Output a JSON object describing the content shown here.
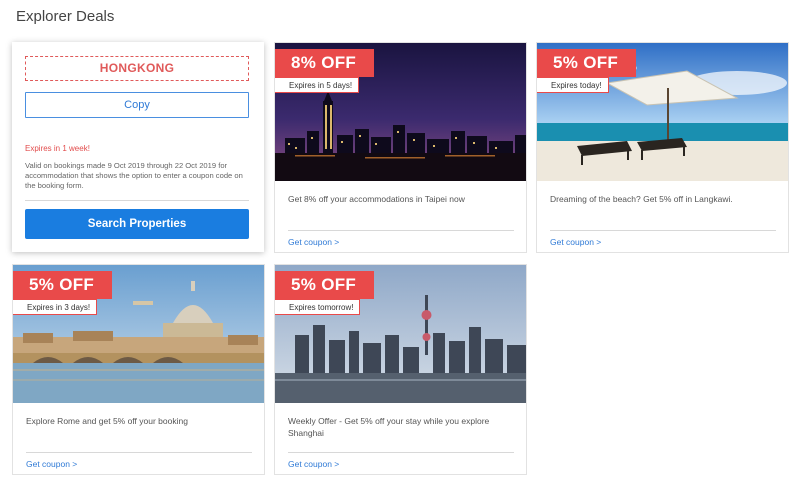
{
  "page": {
    "heading": "Explorer Deals"
  },
  "promo": {
    "code": "HONGKONG",
    "copy_label": "Copy",
    "expires": "Expires in 1 week!",
    "validity": "Valid on bookings made 9 Oct 2019 through 22 Oct 2019 for accommodation that shows the option to enter a coupon code on the booking form.",
    "search_label": "Search Properties"
  },
  "deals": [
    {
      "discount": "8% OFF",
      "expiry": "Expires in 5 days!",
      "description": "Get 8% off your accommodations in Taipei now",
      "link": "Get coupon >"
    },
    {
      "discount": "5% OFF",
      "expiry": "Expires today!",
      "description": "Dreaming of the beach? Get 5% off in Langkawi.",
      "link": "Get coupon >"
    },
    {
      "discount": "5% OFF",
      "expiry": "Expires in 3 days!",
      "description": "Explore Rome and get 5% off your booking",
      "link": "Get coupon >"
    },
    {
      "discount": "5% OFF",
      "expiry": "Expires tomorrow!",
      "description": "Weekly Offer - Get 5% off your stay while you explore Shanghai",
      "link": "Get coupon >"
    }
  ],
  "colors": {
    "accent_red": "#e94a4a",
    "link_blue": "#2f7ad6",
    "button_blue": "#1a7de0"
  }
}
